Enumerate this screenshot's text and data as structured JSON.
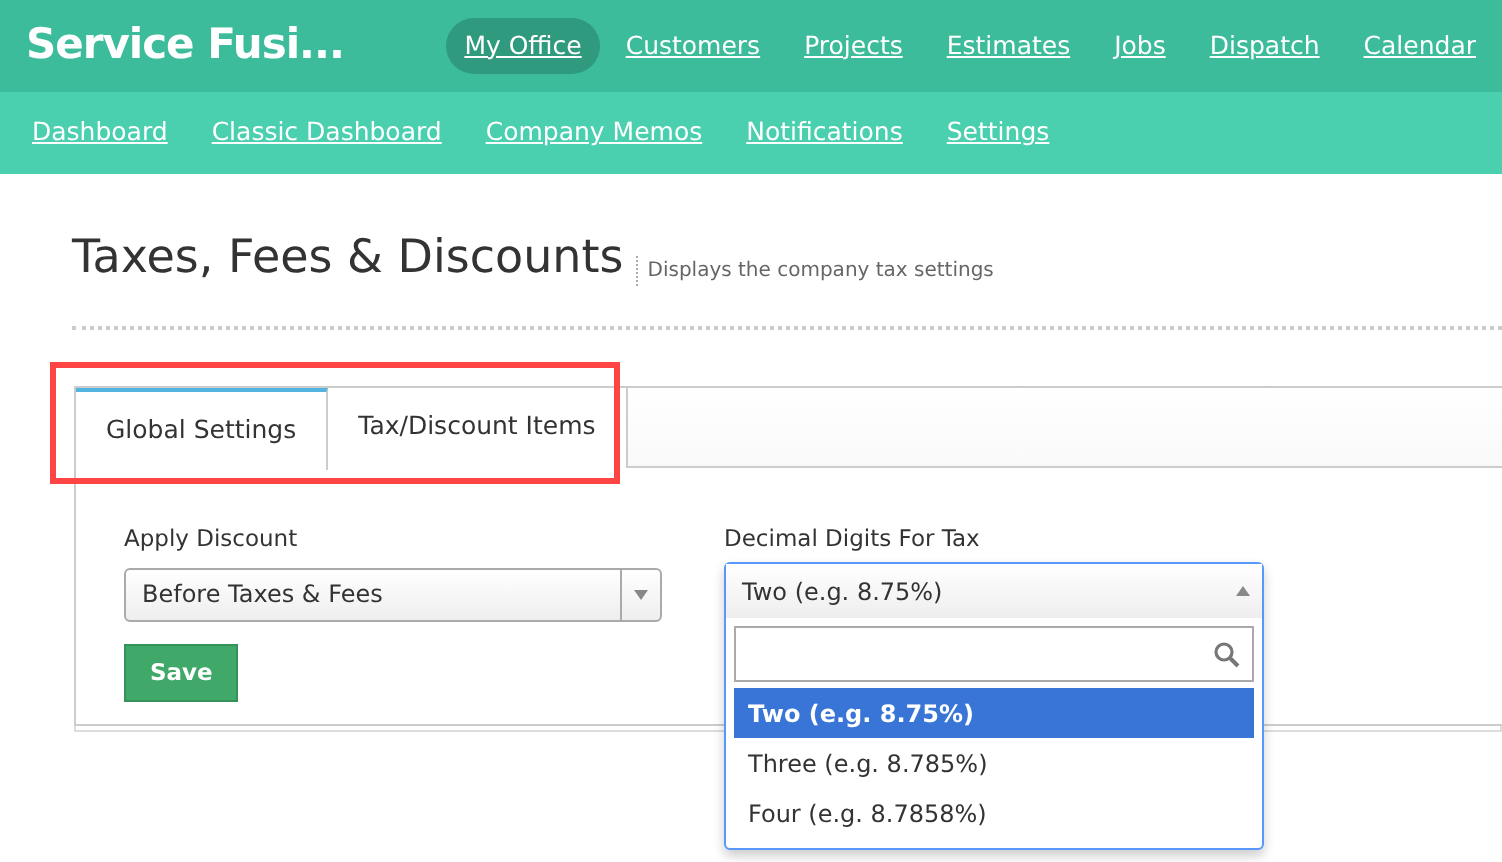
{
  "brand": "Service Fusi...",
  "main_nav": [
    {
      "label": "My Office",
      "selected": true
    },
    {
      "label": "Customers",
      "selected": false
    },
    {
      "label": "Projects",
      "selected": false
    },
    {
      "label": "Estimates",
      "selected": false
    },
    {
      "label": "Jobs",
      "selected": false
    },
    {
      "label": "Dispatch",
      "selected": false
    },
    {
      "label": "Calendar",
      "selected": false
    }
  ],
  "sub_nav": [
    "Dashboard",
    "Classic Dashboard",
    "Company Memos",
    "Notifications",
    "Settings"
  ],
  "page": {
    "title": "Taxes, Fees & Discounts",
    "subtitle": "Displays the company tax settings"
  },
  "tabs": [
    {
      "label": "Global Settings",
      "selected": true
    },
    {
      "label": "Tax/Discount Items",
      "selected": false
    }
  ],
  "apply_discount": {
    "label": "Apply Discount",
    "value": "Before Taxes & Fees"
  },
  "save_button": "Save",
  "decimal_digits": {
    "label": "Decimal Digits For Tax",
    "value": "Two (e.g. 8.75%)",
    "expanded": true,
    "options": [
      {
        "label": "Two (e.g. 8.75%)",
        "selected": true
      },
      {
        "label": "Three (e.g. 8.785%)",
        "selected": false
      },
      {
        "label": "Four (e.g. 8.7858%)",
        "selected": false
      }
    ]
  }
}
